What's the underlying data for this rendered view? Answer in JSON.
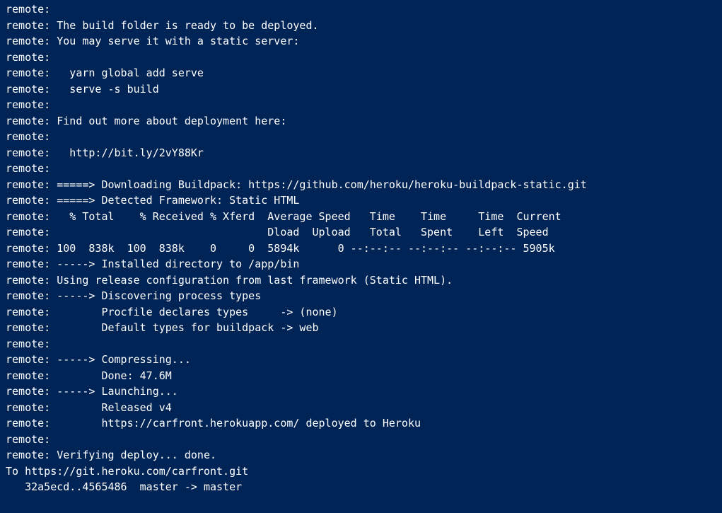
{
  "terminal": {
    "lines": [
      "remote:",
      "remote: The build folder is ready to be deployed.",
      "remote: You may serve it with a static server:",
      "remote:",
      "remote:   yarn global add serve",
      "remote:   serve -s build",
      "remote:",
      "remote: Find out more about deployment here:",
      "remote:",
      "remote:   http://bit.ly/2vY88Kr",
      "remote:",
      "remote: =====> Downloading Buildpack: https://github.com/heroku/heroku-buildpack-static.git",
      "remote: =====> Detected Framework: Static HTML",
      "remote:   % Total    % Received % Xferd  Average Speed   Time    Time     Time  Current",
      "remote:                                  Dload  Upload   Total   Spent    Left  Speed",
      "remote: 100  838k  100  838k    0     0  5894k      0 --:--:-- --:--:-- --:--:-- 5905k",
      "remote: -----> Installed directory to /app/bin",
      "remote: Using release configuration from last framework (Static HTML).",
      "remote: -----> Discovering process types",
      "remote:        Procfile declares types     -> (none)",
      "remote:        Default types for buildpack -> web",
      "remote:",
      "remote: -----> Compressing...",
      "remote:        Done: 47.6M",
      "remote: -----> Launching...",
      "remote:        Released v4",
      "remote:        https://carfront.herokuapp.com/ deployed to Heroku",
      "remote:",
      "remote: Verifying deploy... done.",
      "To https://git.heroku.com/carfront.git",
      "   32a5ecd..4565486  master -> master"
    ]
  }
}
